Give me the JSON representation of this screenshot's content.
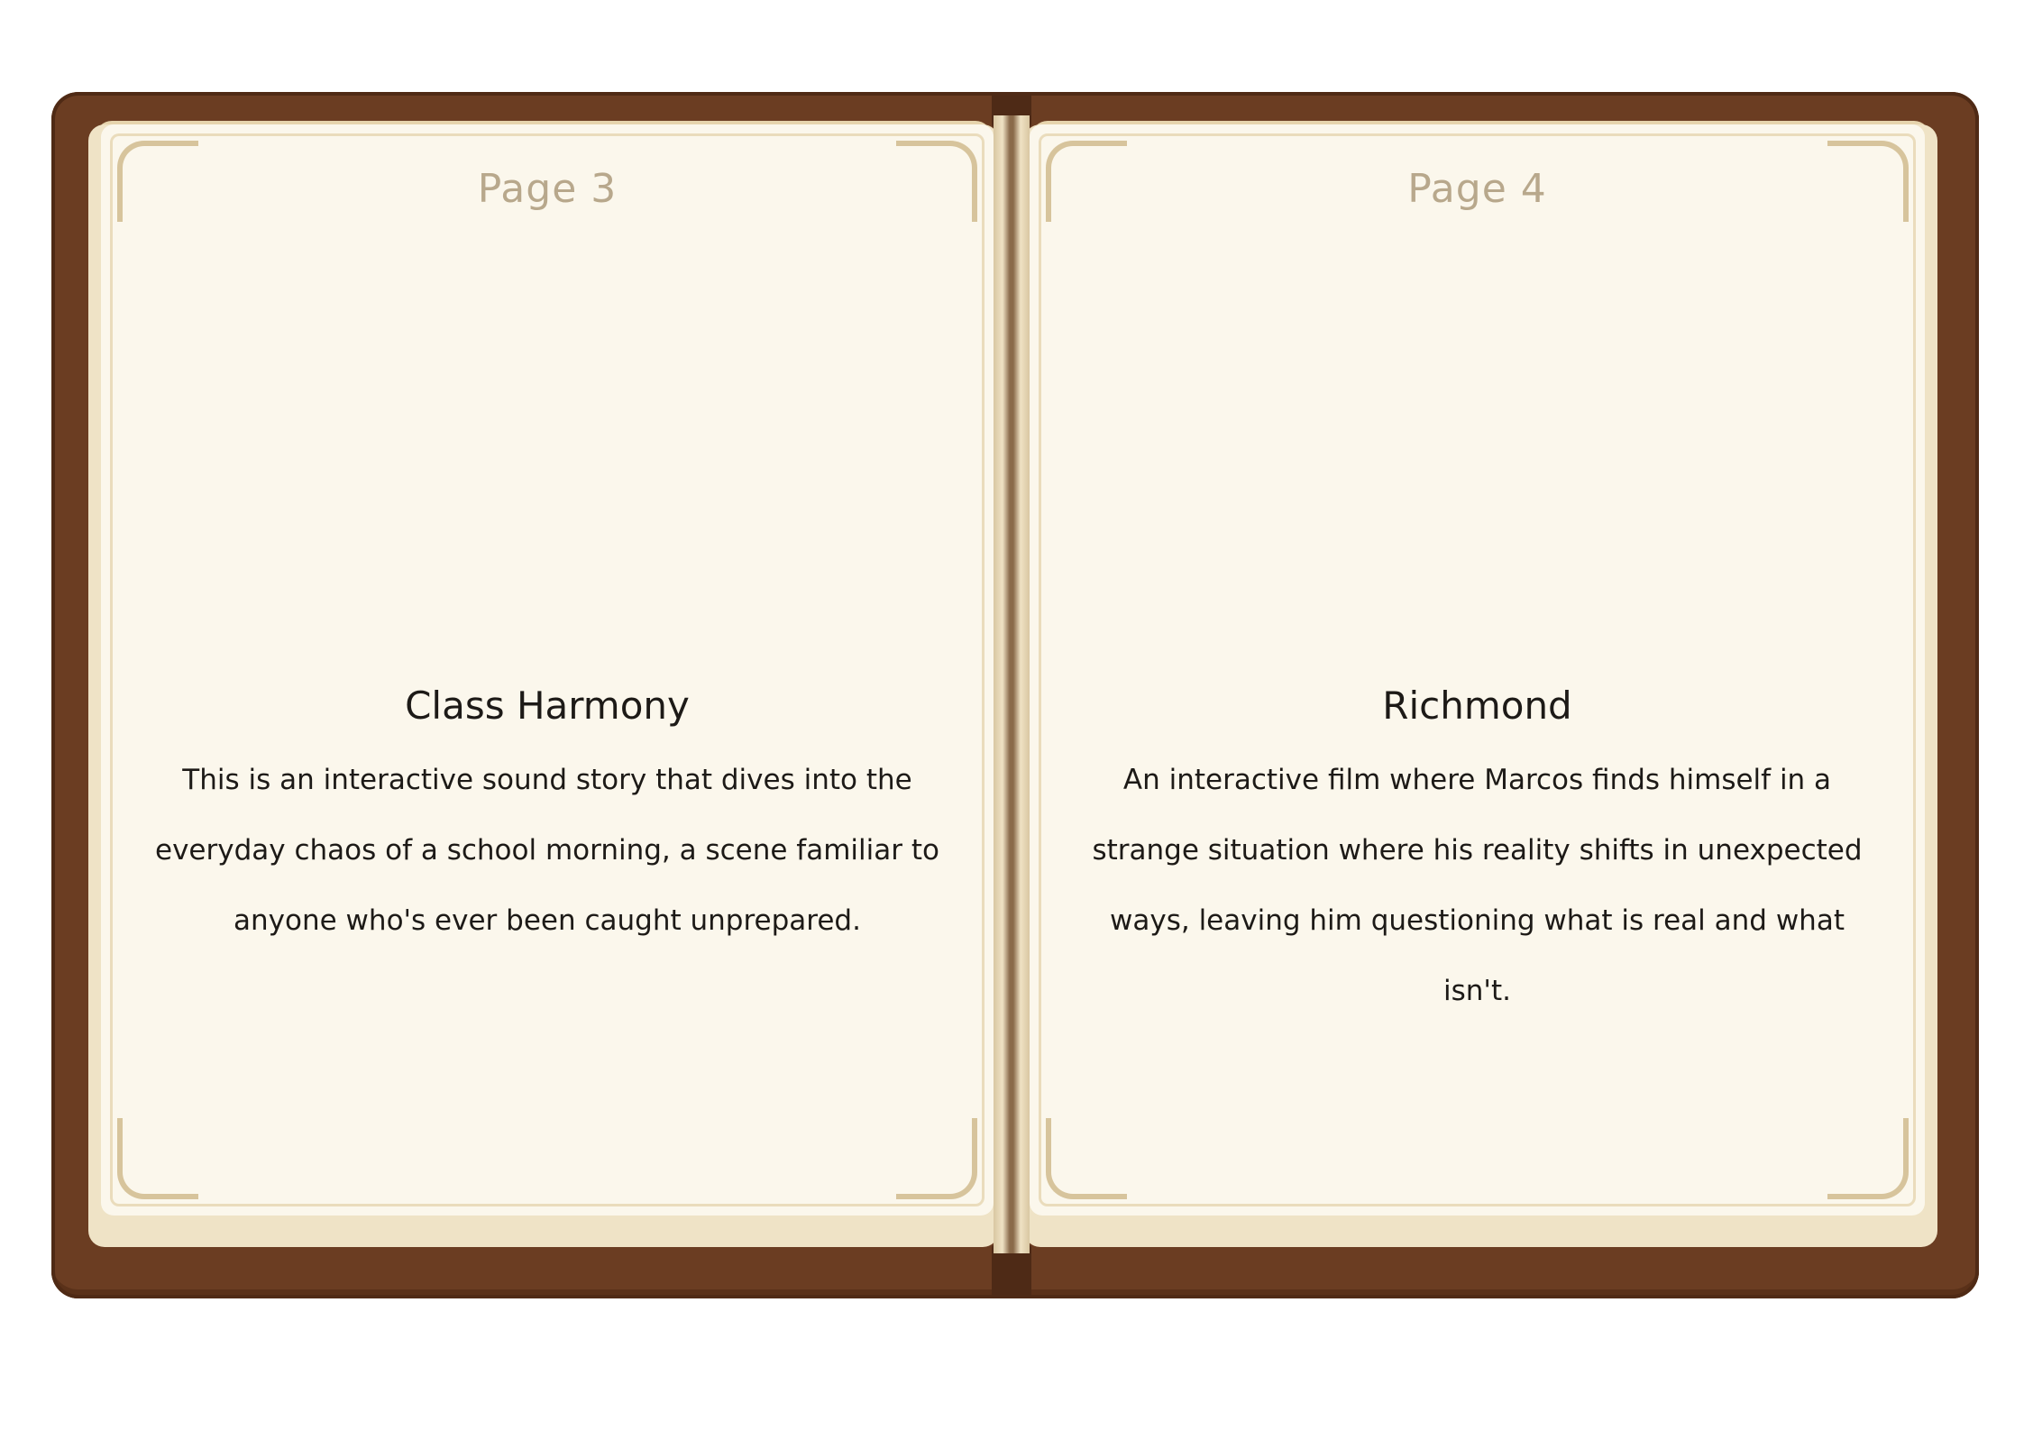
{
  "book": {
    "left_page": {
      "page_label": "Page 3",
      "title": "Class Harmony",
      "description": "This is an interactive sound story that dives into the everyday chaos of a school morning, a scene familiar to anyone who's ever been caught unprepared."
    },
    "right_page": {
      "page_label": "Page 4",
      "title": "Richmond",
      "description": "An interactive film where Marcos finds himself in a strange situation where his reality shifts in unexpected ways, leaving him questioning what is real and what isn't."
    }
  },
  "colors": {
    "cover": "#6b3d22",
    "paper": "#fbf7ec",
    "page_number": "#b8a88c",
    "text": "#1d1a17"
  }
}
